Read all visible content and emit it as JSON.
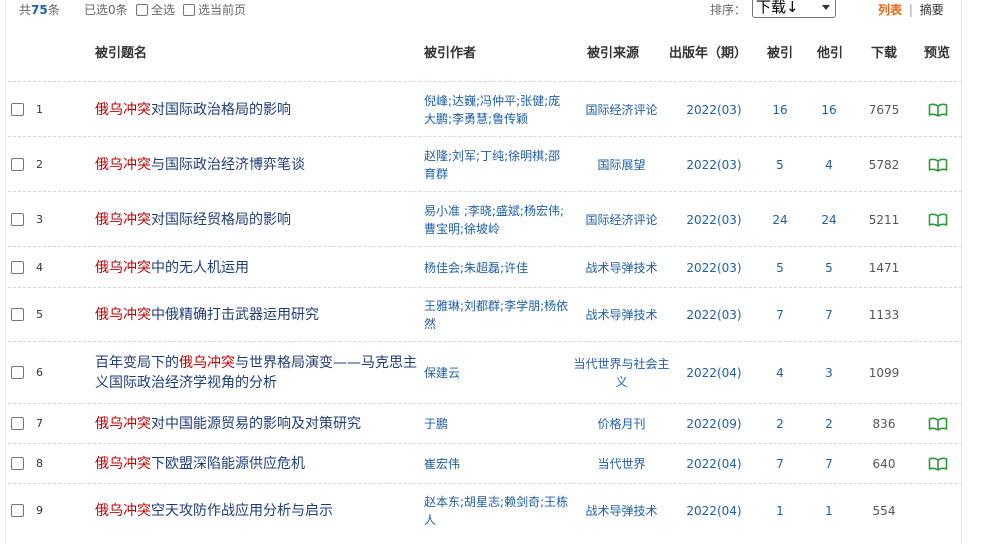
{
  "toolbar": {
    "total_prefix": "共",
    "total_count": "75",
    "total_suffix": "条",
    "selected_text": "已选0条",
    "select_all_label": "全选",
    "select_page_label": "选当前页",
    "sort_label": "排序：",
    "sort_value": "下载↓",
    "view_list": "列表",
    "view_sep": "|",
    "view_abstract": "摘要"
  },
  "columns": {
    "title": "被引题名",
    "authors": "被引作者",
    "source": "被引来源",
    "year": "出版年（期）",
    "cited": "被引",
    "other_cited": "他引",
    "downloads": "下载",
    "preview": "预览"
  },
  "colors": {
    "link": "#1f3d7a",
    "highlight": "#c00000",
    "accent_orange": "#e46a1b",
    "preview_icon": "#2e9a3a"
  },
  "rows": [
    {
      "num": "1",
      "title_pre": "",
      "title_hl": "俄乌冲突",
      "title_post": "对国际政治格局的影响",
      "authors": "倪峰;达巍;冯仲平;张健;庞大鹏;李勇慧;鲁传颖",
      "source": "国际经济评论",
      "year": "2022(03)",
      "cited": "16",
      "other_cited": "16",
      "downloads": "7675",
      "preview": "book-icon"
    },
    {
      "num": "2",
      "title_pre": "",
      "title_hl": "俄乌冲突",
      "title_post": "与国际政治经济博弈笔谈",
      "authors": "赵隆;刘军;丁纯;徐明棋;邵育群",
      "source": "国际展望",
      "year": "2022(03)",
      "cited": "5",
      "other_cited": "4",
      "downloads": "5782",
      "preview": "book-icon"
    },
    {
      "num": "3",
      "title_pre": "",
      "title_hl": "俄乌冲突",
      "title_post": "对国际经贸格局的影响",
      "authors": "易小准 ;李晓;盛斌;杨宏伟;曹宝明;徐坡岭",
      "source": "国际经济评论",
      "year": "2022(03)",
      "cited": "24",
      "other_cited": "24",
      "downloads": "5211",
      "preview": "book-icon"
    },
    {
      "num": "4",
      "title_pre": "",
      "title_hl": "俄乌冲突",
      "title_post": "中的无人机运用",
      "authors": "杨佳会;朱超磊;许佳",
      "source": "战术导弹技术",
      "year": "2022(03)",
      "cited": "5",
      "other_cited": "5",
      "downloads": "1471",
      "preview": ""
    },
    {
      "num": "5",
      "title_pre": "",
      "title_hl": "俄乌冲突",
      "title_post": "中俄精确打击武器运用研究",
      "authors": "王雅琳;刘都群;李学朋;杨依然",
      "source": "战术导弹技术",
      "year": "2022(03)",
      "cited": "7",
      "other_cited": "7",
      "downloads": "1133",
      "preview": ""
    },
    {
      "num": "6",
      "title_pre": "百年变局下的",
      "title_hl": "俄乌冲突",
      "title_post": "与世界格局演变——马克思主义国际政治经济学视角的分析",
      "authors": "保建云",
      "source": "当代世界与社会主义",
      "year": "2022(04)",
      "cited": "4",
      "other_cited": "3",
      "downloads": "1099",
      "preview": ""
    },
    {
      "num": "7",
      "title_pre": "",
      "title_hl": "俄乌冲突",
      "title_post": "对中国能源贸易的影响及对策研究",
      "authors": "于鹏",
      "source": "价格月刊",
      "year": "2022(09)",
      "cited": "2",
      "other_cited": "2",
      "downloads": "836",
      "preview": "book-icon"
    },
    {
      "num": "8",
      "title_pre": "",
      "title_hl": "俄乌冲突",
      "title_post": "下欧盟深陷能源供应危机",
      "authors": "崔宏伟",
      "source": "当代世界",
      "year": "2022(04)",
      "cited": "7",
      "other_cited": "7",
      "downloads": "640",
      "preview": "book-icon"
    },
    {
      "num": "9",
      "title_pre": "",
      "title_hl": "俄乌冲突",
      "title_post": "空天攻防作战应用分析与启示",
      "authors": "赵本东;胡星志;赖剑奇;王栋人",
      "source": "战术导弹技术",
      "year": "2022(04)",
      "cited": "1",
      "other_cited": "1",
      "downloads": "554",
      "preview": ""
    }
  ]
}
